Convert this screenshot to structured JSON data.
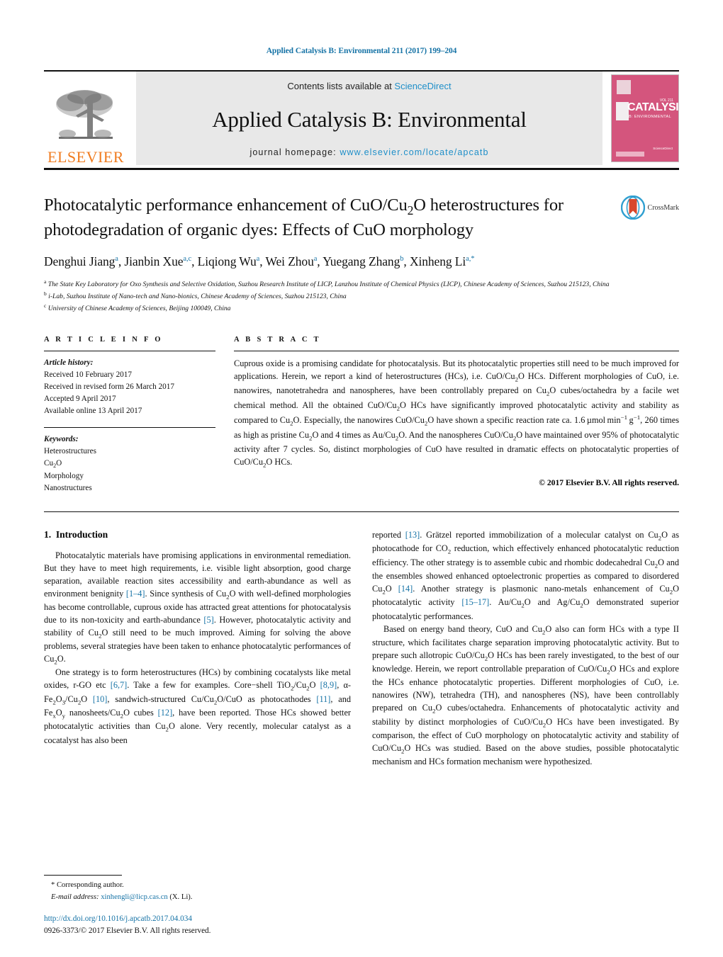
{
  "running_head": "Applied Catalysis B: Environmental 211 (2017) 199–204",
  "masthead": {
    "publisher_name": "ELSEVIER",
    "contents_prefix": "Contents lists available at ",
    "contents_link": "ScienceDirect",
    "journal_title": "Applied Catalysis B: Environmental",
    "homepage_prefix": "journal homepage: ",
    "homepage_url": "www.elsevier.com/locate/apcatb",
    "cover": {
      "title": "CATALYSIS",
      "subtitle": "B: ENVIRONMENTAL",
      "superscript": "VOL 211",
      "footer": "Available online at\nScienceDirect"
    }
  },
  "article": {
    "title": "Photocatalytic performance enhancement of CuO/Cu₂O heterostructures for photodegradation of organic dyes: Effects of CuO morphology",
    "title_parts": [
      {
        "t": "Photocatalytic performance enhancement of CuO/Cu"
      },
      {
        "t": "2",
        "sub": true
      },
      {
        "t": "O heterostructures for photodegradation of organic dyes: Effects of CuO morphology"
      }
    ],
    "crossmark_label": "CrossMark",
    "authors": [
      {
        "name": "Denghui Jiang",
        "marks": "a"
      },
      {
        "name": "Jianbin Xue",
        "marks": "a,c"
      },
      {
        "name": "Liqiong Wu",
        "marks": "a"
      },
      {
        "name": "Wei Zhou",
        "marks": "a"
      },
      {
        "name": "Yuegang Zhang",
        "marks": "b"
      },
      {
        "name": "Xinheng Li",
        "marks": "a,*"
      }
    ],
    "affiliations": [
      {
        "mark": "a",
        "text": "The State Key Laboratory for Oxo Synthesis and Selective Oxidation, Suzhou Research Institute of LICP, Lanzhou Institute of Chemical Physics (LICP), Chinese Academy of Sciences, Suzhou 215123, China"
      },
      {
        "mark": "b",
        "text": "i-Lab, Suzhou Institute of Nano-tech and Nano-bionics, Chinese Academy of Sciences, Suzhou 215123, China"
      },
      {
        "mark": "c",
        "text": "University of Chinese Academy of Sciences, Beijing 100049, China"
      }
    ]
  },
  "article_info": {
    "heading": "A R T I C L E   I N F O",
    "history_label": "Article history:",
    "history": [
      "Received 10 February 2017",
      "Received in revised form 26 March 2017",
      "Accepted 9 April 2017",
      "Available online 13 April 2017"
    ],
    "keywords_label": "Keywords:",
    "keywords": [
      "Heterostructures",
      "Cu2O",
      "Morphology",
      "Nanostructures"
    ]
  },
  "abstract": {
    "heading": "A B S T R A C T",
    "copyright": "© 2017 Elsevier B.V. All rights reserved."
  },
  "introduction": {
    "section_number": "1.",
    "section_title": "Introduction"
  },
  "footnote": {
    "corresponding": "* Corresponding author.",
    "email_label": "E-mail address:",
    "email": "xinhengli@licp.cas.cn",
    "email_suffix": "(X. Li)."
  },
  "footer": {
    "doi": "http://dx.doi.org/10.1016/j.apcatb.2017.04.034",
    "issn": "0926-3373/© 2017 Elsevier B.V. All rights reserved."
  },
  "colors": {
    "link": "#1673a6",
    "sciencedirect": "#1f8fc9",
    "elsevier_orange": "#f07c20",
    "cover_pink": "#d4557d",
    "masthead_gray": "#e8e8e8"
  }
}
